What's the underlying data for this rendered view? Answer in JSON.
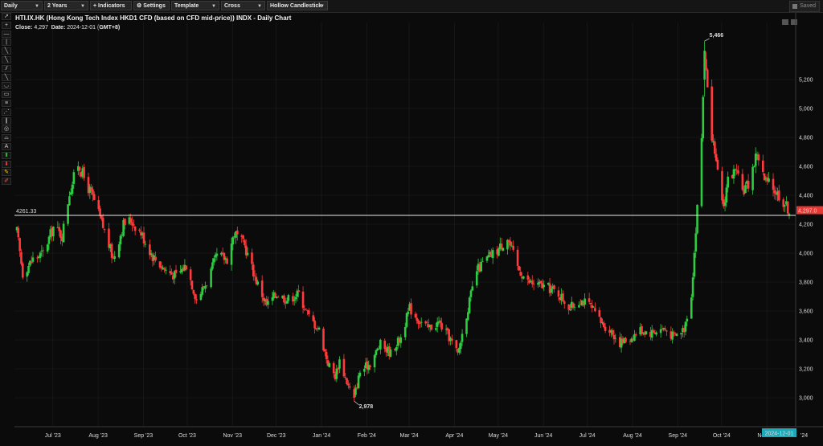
{
  "toolbar": {
    "interval": "Daily",
    "range": "2 Years",
    "indicators": "Indicators",
    "settings": "Settings",
    "template": "Template",
    "crosshair": "Cross",
    "chart_style": "Hollow Candlestick",
    "saved": "Saved"
  },
  "left_tools": [
    "pointer-tool",
    "crosshair-tool",
    "horizontal-line-tool",
    "vertical-line-tool",
    "trend-line-tool",
    "ray-tool",
    "parallel-channel-tool",
    "extended-line-tool",
    "arc-tool",
    "rectangle-tool",
    "fibonacci-retracement-tool",
    "fibonacci-fan-tool",
    "gann-fan-tool",
    "circle-tool",
    "text-arch-tool",
    "text-tool",
    "buy-arrow-tool",
    "sell-arrow-tool",
    "highlighter-tool",
    "eraser-tool"
  ],
  "header": {
    "title": "HTI.IX.HK (Hong Kong Tech Index HKD1 CFD (based on CFD mid-price)) INDX - Daily Chart",
    "close_label": "Close:",
    "close_value": "4,297",
    "date_label": "Date:",
    "date_value": "2024-12-01",
    "tz": "(GMT+8)"
  },
  "colors": {
    "up": "#2ecc40",
    "down": "#ff3b3b",
    "background": "#0b0b0b",
    "grid": "#1f1f1f",
    "current_price_badge": "#e53935",
    "date_badge": "#1fa8b8"
  },
  "chart_data": {
    "type": "candlestick",
    "ylim": [
      2880,
      5520
    ],
    "y_ticks": [
      3000,
      3200,
      3400,
      3600,
      3800,
      4000,
      4200,
      4400,
      4600,
      4800,
      5000,
      5200
    ],
    "y_tick_labels": [
      "3,000",
      "3,200",
      "3,400",
      "3,600",
      "3,800",
      "4,000",
      "4,200",
      "4,400",
      "4,600",
      "4,800",
      "5,000",
      "5,200"
    ],
    "x_labels": [
      "Jul '23",
      "Aug '23",
      "Sep '23",
      "Oct '23",
      "Nov '23",
      "Dec '23",
      "Jan '24",
      "Feb '24",
      "Mar '24",
      "Apr '24",
      "May '24",
      "Jun '24",
      "Jul '24",
      "Aug '24",
      "Sep '24",
      "Oct '24",
      "Nov '24"
    ],
    "reference_line": {
      "value": 4261.33,
      "label": "4261.33"
    },
    "current_price": {
      "value": 4297.0,
      "label": "4,297.0"
    },
    "current_date": "2024-12-01",
    "annotations": [
      {
        "text": "5,466",
        "value": 5466,
        "date": "2024-10-02"
      },
      {
        "text": "2,978",
        "value": 2978,
        "date": "2024-02-05"
      }
    ],
    "anchors": [
      {
        "d": "2023-06-19",
        "v": 4150
      },
      {
        "d": "2023-06-23",
        "v": 3860
      },
      {
        "d": "2023-06-30",
        "v": 3960
      },
      {
        "d": "2023-07-07",
        "v": 4000
      },
      {
        "d": "2023-07-14",
        "v": 4180
      },
      {
        "d": "2023-07-20",
        "v": 4120
      },
      {
        "d": "2023-07-25",
        "v": 4420
      },
      {
        "d": "2023-07-31",
        "v": 4620
      },
      {
        "d": "2023-08-04",
        "v": 4520
      },
      {
        "d": "2023-08-11",
        "v": 4360
      },
      {
        "d": "2023-08-18",
        "v": 4150
      },
      {
        "d": "2023-08-24",
        "v": 3960
      },
      {
        "d": "2023-08-31",
        "v": 4200
      },
      {
        "d": "2023-09-05",
        "v": 4230
      },
      {
        "d": "2023-09-12",
        "v": 4140
      },
      {
        "d": "2023-09-20",
        "v": 3980
      },
      {
        "d": "2023-09-28",
        "v": 3890
      },
      {
        "d": "2023-10-06",
        "v": 3840
      },
      {
        "d": "2023-10-13",
        "v": 3920
      },
      {
        "d": "2023-10-20",
        "v": 3680
      },
      {
        "d": "2023-10-27",
        "v": 3800
      },
      {
        "d": "2023-11-03",
        "v": 3980
      },
      {
        "d": "2023-11-10",
        "v": 3960
      },
      {
        "d": "2023-11-15",
        "v": 4140
      },
      {
        "d": "2023-11-22",
        "v": 4050
      },
      {
        "d": "2023-11-30",
        "v": 3810
      },
      {
        "d": "2023-12-07",
        "v": 3640
      },
      {
        "d": "2023-12-14",
        "v": 3720
      },
      {
        "d": "2023-12-21",
        "v": 3680
      },
      {
        "d": "2023-12-29",
        "v": 3720
      },
      {
        "d": "2024-01-05",
        "v": 3560
      },
      {
        "d": "2024-01-12",
        "v": 3470
      },
      {
        "d": "2024-01-18",
        "v": 3240
      },
      {
        "d": "2024-01-23",
        "v": 3150
      },
      {
        "d": "2024-01-26",
        "v": 3260
      },
      {
        "d": "2024-02-01",
        "v": 3080
      },
      {
        "d": "2024-02-05",
        "v": 3010
      },
      {
        "d": "2024-02-09",
        "v": 3180
      },
      {
        "d": "2024-02-16",
        "v": 3240
      },
      {
        "d": "2024-02-23",
        "v": 3370
      },
      {
        "d": "2024-03-01",
        "v": 3310
      },
      {
        "d": "2024-03-08",
        "v": 3420
      },
      {
        "d": "2024-03-14",
        "v": 3620
      },
      {
        "d": "2024-03-20",
        "v": 3540
      },
      {
        "d": "2024-03-27",
        "v": 3480
      },
      {
        "d": "2024-04-03",
        "v": 3520
      },
      {
        "d": "2024-04-10",
        "v": 3420
      },
      {
        "d": "2024-04-16",
        "v": 3300
      },
      {
        "d": "2024-04-22",
        "v": 3580
      },
      {
        "d": "2024-04-29",
        "v": 3880
      },
      {
        "d": "2024-05-06",
        "v": 3960
      },
      {
        "d": "2024-05-14",
        "v": 4030
      },
      {
        "d": "2024-05-20",
        "v": 4110
      },
      {
        "d": "2024-05-27",
        "v": 3900
      },
      {
        "d": "2024-06-03",
        "v": 3800
      },
      {
        "d": "2024-06-10",
        "v": 3780
      },
      {
        "d": "2024-06-17",
        "v": 3760
      },
      {
        "d": "2024-06-24",
        "v": 3720
      },
      {
        "d": "2024-07-02",
        "v": 3620
      },
      {
        "d": "2024-07-09",
        "v": 3680
      },
      {
        "d": "2024-07-16",
        "v": 3630
      },
      {
        "d": "2024-07-23",
        "v": 3520
      },
      {
        "d": "2024-07-30",
        "v": 3460
      },
      {
        "d": "2024-08-05",
        "v": 3380
      },
      {
        "d": "2024-08-12",
        "v": 3410
      },
      {
        "d": "2024-08-19",
        "v": 3470
      },
      {
        "d": "2024-08-26",
        "v": 3450
      },
      {
        "d": "2024-09-04",
        "v": 3480
      },
      {
        "d": "2024-09-11",
        "v": 3420
      },
      {
        "d": "2024-09-18",
        "v": 3480
      },
      {
        "d": "2024-09-23",
        "v": 3720
      },
      {
        "d": "2024-09-26",
        "v": 4150
      },
      {
        "d": "2024-09-30",
        "v": 4800
      },
      {
        "d": "2024-10-02",
        "v": 5380
      },
      {
        "d": "2024-10-04",
        "v": 5100
      },
      {
        "d": "2024-10-08",
        "v": 4730
      },
      {
        "d": "2024-10-10",
        "v": 4600
      },
      {
        "d": "2024-10-15",
        "v": 4320
      },
      {
        "d": "2024-10-18",
        "v": 4520
      },
      {
        "d": "2024-10-23",
        "v": 4560
      },
      {
        "d": "2024-10-28",
        "v": 4430
      },
      {
        "d": "2024-11-01",
        "v": 4480
      },
      {
        "d": "2024-11-07",
        "v": 4700
      },
      {
        "d": "2024-11-12",
        "v": 4500
      },
      {
        "d": "2024-11-18",
        "v": 4450
      },
      {
        "d": "2024-11-22",
        "v": 4400
      },
      {
        "d": "2024-11-29",
        "v": 4297
      }
    ]
  }
}
